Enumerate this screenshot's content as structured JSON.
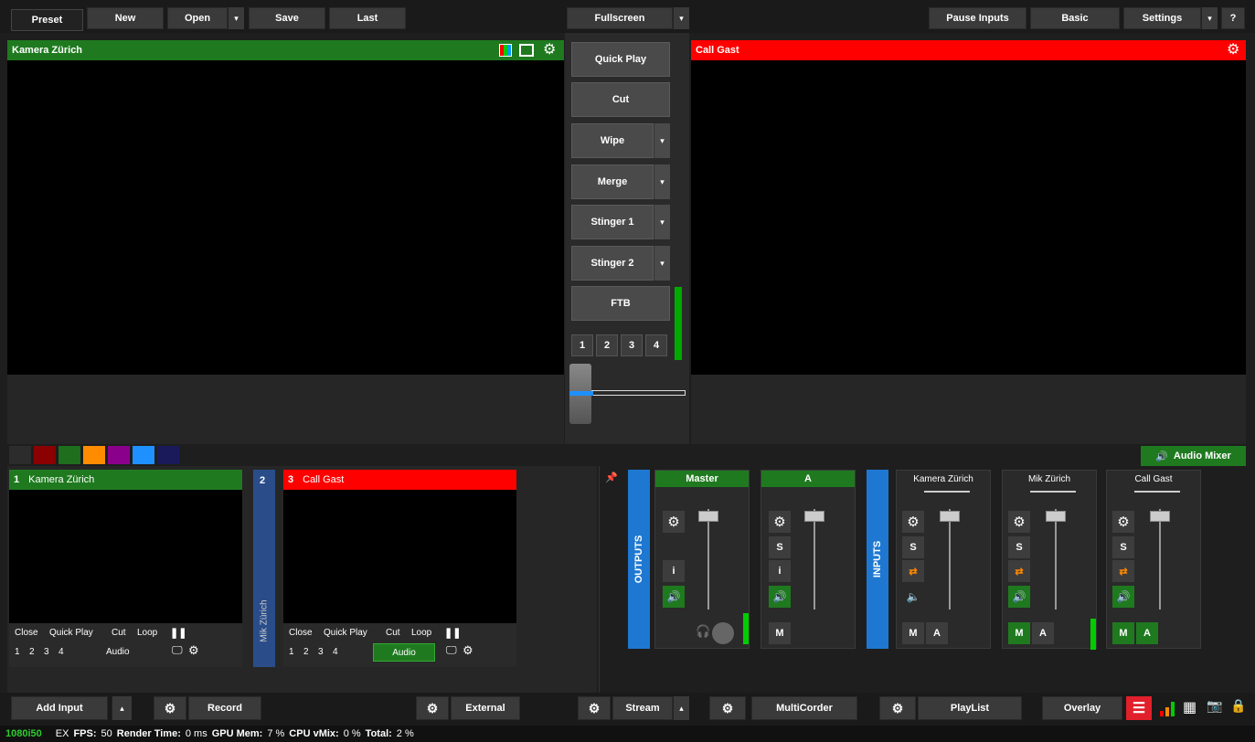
{
  "toolbar": {
    "preset": "Preset",
    "new": "New",
    "open": "Open",
    "save": "Save",
    "last": "Last",
    "fullscreen": "Fullscreen",
    "pause_inputs": "Pause Inputs",
    "basic": "Basic",
    "settings": "Settings",
    "help": "?"
  },
  "preview": {
    "title": "Kamera Zürich"
  },
  "output": {
    "title": "Call Gast"
  },
  "transitions": {
    "quick_play": "Quick Play",
    "cut": "Cut",
    "wipe": "Wipe",
    "merge": "Merge",
    "stinger1": "Stinger 1",
    "stinger2": "Stinger 2",
    "ftb": "FTB",
    "nums": [
      "1",
      "2",
      "3",
      "4"
    ]
  },
  "color_tags": [
    "#2c2c2c",
    "#8b0000",
    "#1e6e1e",
    "#ff8c00",
    "#8b008b",
    "#1e90ff",
    "#1a1a5a"
  ],
  "inputs": [
    {
      "number": "1",
      "name": "Kamera Zürich",
      "color": "#1f7a1f"
    },
    {
      "number": "2",
      "name": "Mik Zürich",
      "color": "#2a4d8a"
    },
    {
      "number": "3",
      "name": "Call Gast",
      "color": "#ff0000"
    }
  ],
  "input_controls": {
    "close": "Close",
    "quick_play": "Quick Play",
    "cut": "Cut",
    "loop": "Loop",
    "nums": [
      "1",
      "2",
      "3",
      "4"
    ],
    "audio": "Audio"
  },
  "audio_mixer": {
    "button": "Audio Mixer",
    "outputs_label": "OUTPUTS",
    "inputs_label": "INPUTS",
    "master": "Master",
    "a_bus": "A",
    "channels": [
      "Kamera Zürich",
      "Mik Zürich",
      "Call Gast"
    ],
    "s": "S",
    "i": "i",
    "m": "M",
    "a": "A"
  },
  "bottom": {
    "add_input": "Add Input",
    "record": "Record",
    "external": "External",
    "stream": "Stream",
    "multicorder": "MultiCorder",
    "playlist": "PlayList",
    "overlay": "Overlay"
  },
  "status": {
    "format": "1080i50",
    "ex": "EX",
    "fps_label": "FPS:",
    "fps": "50",
    "render_label": "Render Time:",
    "render": "0 ms",
    "gpu_label": "GPU Mem:",
    "gpu": "7 %",
    "cpu_label": "CPU vMix:",
    "cpu": "0 %",
    "total_label": "Total:",
    "total": "2 %"
  }
}
